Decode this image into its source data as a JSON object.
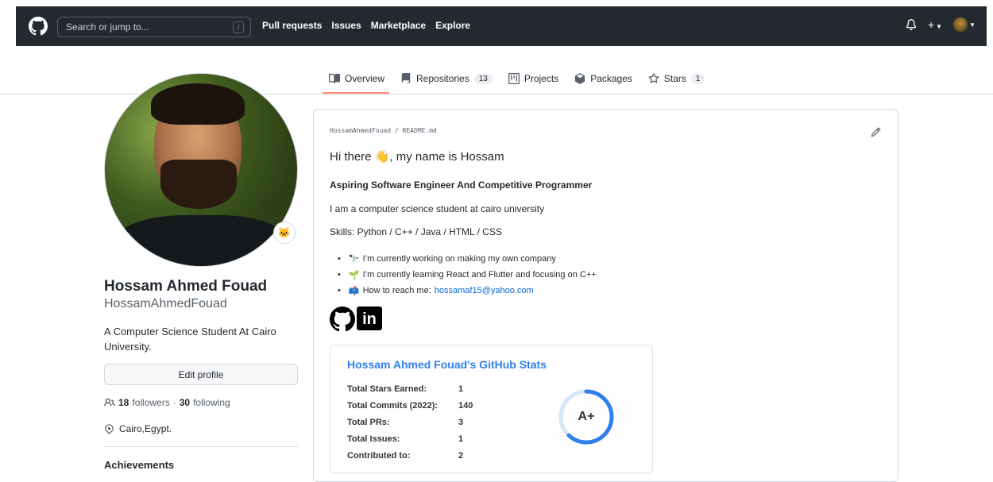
{
  "header": {
    "search_placeholder": "Search or jump to...",
    "search_shortcut": "/",
    "nav": [
      "Pull requests",
      "Issues",
      "Marketplace",
      "Explore"
    ]
  },
  "tabs": [
    {
      "label": "Overview",
      "icon": "book-icon"
    },
    {
      "label": "Repositories",
      "count": "13",
      "icon": "repo-icon"
    },
    {
      "label": "Projects",
      "icon": "project-icon"
    },
    {
      "label": "Packages",
      "icon": "package-icon"
    },
    {
      "label": "Stars",
      "count": "1",
      "icon": "star-icon"
    }
  ],
  "profile": {
    "name": "Hossam Ahmed Fouad",
    "username": "HossamAhmedFouad",
    "bio": "A Computer Science Student At Cairo University.",
    "edit_label": "Edit profile",
    "followers": "18",
    "followers_label": "followers",
    "following": "30",
    "following_label": "following",
    "location": "Cairo,Egypt.",
    "achievements_heading": "Achievements"
  },
  "readme": {
    "path": "HossamAhmedFouad / README.md",
    "greeting_prefix": "Hi there ",
    "greeting_suffix": ", my name is Hossam",
    "subtitle": "Aspiring Software Engineer And Competitive Programmer",
    "intro": "I am a computer science student at cairo university",
    "skills": "Skills: Python / C++ / Java / HTML / CSS",
    "bullets": [
      {
        "emoji": "🔭",
        "text": "I’m currently working on making my own company"
      },
      {
        "emoji": "🌱",
        "text": "I’m currently learning React and Flutter and focusing on C++"
      },
      {
        "emoji": "📫",
        "text": "How to reach me: ",
        "link": "hossamaf15@yahoo.com"
      }
    ],
    "linkedin_text": "in"
  },
  "stats": {
    "title": "Hossam Ahmed Fouad's GitHub Stats",
    "rows": [
      {
        "label": "Total Stars Earned:",
        "value": "1"
      },
      {
        "label": "Total Commits (2022):",
        "value": "140"
      },
      {
        "label": "Total PRs:",
        "value": "3"
      },
      {
        "label": "Total Issues:",
        "value": "1"
      },
      {
        "label": "Contributed to:",
        "value": "2"
      }
    ],
    "rank": "A+",
    "rank_progress": 0.62,
    "accent": "#2f80ed"
  }
}
